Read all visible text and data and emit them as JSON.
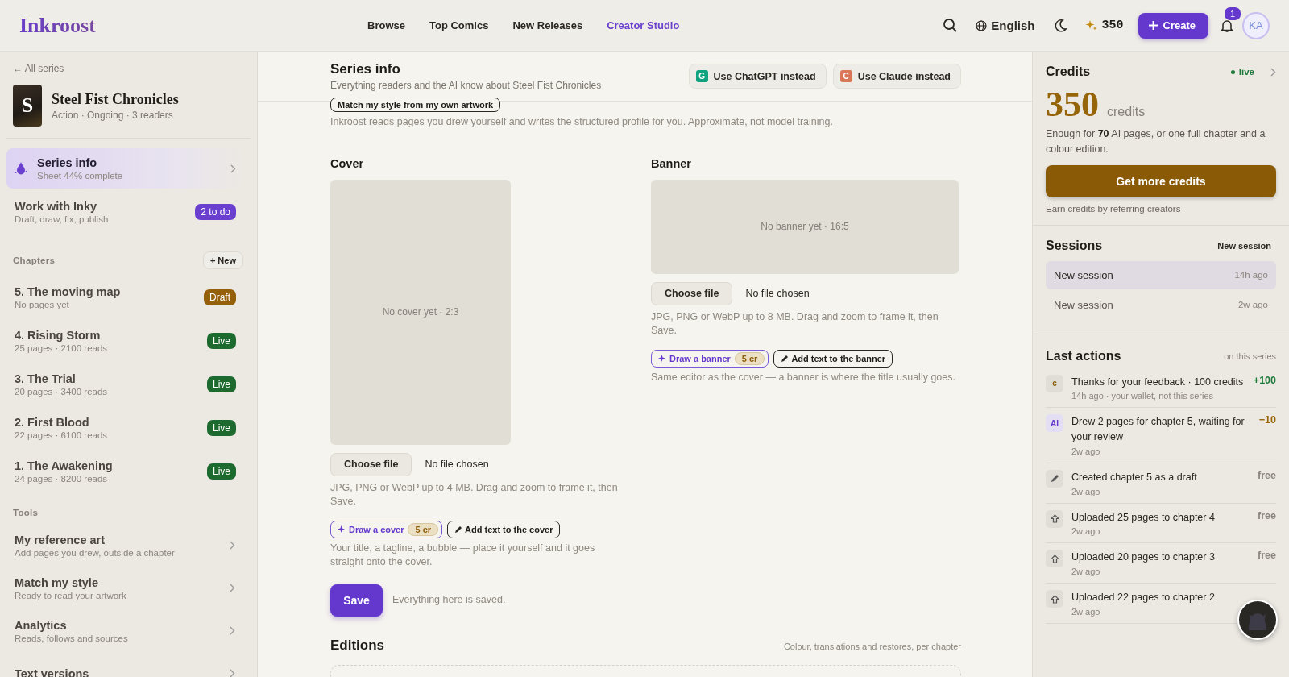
{
  "header": {
    "logo": "Inkroost",
    "nav": [
      {
        "label": "Browse",
        "selected": false
      },
      {
        "label": "Top Comics",
        "selected": false
      },
      {
        "label": "New Releases",
        "selected": false
      },
      {
        "label": "Creator Studio",
        "selected": true
      }
    ],
    "language": "English",
    "credits": "350",
    "create": "Create",
    "notifications": "1",
    "avatar": "KA"
  },
  "sidebar": {
    "back": "← All series",
    "series": {
      "cover_letter": "S",
      "title": "Steel Fist Chronicles",
      "meta": "Action · Ongoing · 3 readers"
    },
    "items": [
      {
        "kind": "progress",
        "title": "Series info",
        "subtitle": "Sheet 44% complete",
        "selected": true
      },
      {
        "kind": "badge",
        "title": "Work with Inky",
        "subtitle": "Draft, draw, fix, publish",
        "badge": "2 to do",
        "selected": false
      }
    ],
    "chapters_label": "Chapters",
    "new_button": "+ New",
    "chapters": [
      {
        "title": "5. The moving map",
        "subtitle": "No pages yet",
        "status": "Draft",
        "kind": "draft"
      },
      {
        "title": "4. Rising Storm",
        "subtitle": "25 pages · 2100 reads",
        "status": "Live",
        "kind": "live"
      },
      {
        "title": "3. The Trial",
        "subtitle": "20 pages · 3400 reads",
        "status": "Live",
        "kind": "live"
      },
      {
        "title": "2. First Blood",
        "subtitle": "22 pages · 6100 reads",
        "status": "Live",
        "kind": "live"
      },
      {
        "title": "1. The Awakening",
        "subtitle": "24 pages · 8200 reads",
        "status": "Live",
        "kind": "live"
      }
    ],
    "tools_label": "Tools",
    "tools": [
      {
        "title": "My reference art",
        "subtitle": "Add pages you drew, outside a chapter"
      },
      {
        "title": "Match my style",
        "subtitle": "Ready to read your artwork"
      },
      {
        "title": "Analytics",
        "subtitle": "Reads, follows and sources"
      },
      {
        "title": "Text versions"
      }
    ]
  },
  "main": {
    "title": "Series info",
    "subtitle": "Everything readers and the AI know about Steel Fist Chronicles",
    "assist_buttons": [
      {
        "letter": "G",
        "label": "Use ChatGPT instead",
        "color": "#10a37f"
      },
      {
        "letter": "C",
        "label": "Use Claude instead",
        "color": "#d97757"
      }
    ],
    "style_button": "Match my style from my own artwork",
    "style_note": "Inkroost reads pages you drew yourself and writes the structured profile for you. Approximate, not model training.",
    "media": [
      {
        "kind": "cover",
        "title": "Cover",
        "placeholder": "No cover yet · 2:3",
        "choose": "Choose file",
        "file": "No file chosen",
        "hint": "JPG, PNG or WebP up to 4 MB. Drag and zoom to frame it, then Save.",
        "draw": "Draw a cover",
        "cost": "5 cr",
        "text_button": "Add text to the cover",
        "note": "Your title, a tagline, a bubble — place it yourself and it goes straight onto the cover."
      },
      {
        "kind": "banner",
        "title": "Banner",
        "placeholder": "No banner yet · 16:5",
        "choose": "Choose file",
        "file": "No file chosen",
        "hint": "JPG, PNG or WebP up to 8 MB. Drag and zoom to frame it, then Save.",
        "draw": "Draw a banner",
        "cost": "5 cr",
        "text_button": "Add text to the banner",
        "note": "Same editor as the cover — a banner is where the title usually goes."
      }
    ],
    "save": "Save",
    "save_note": "Everything here is saved.",
    "editions": {
      "title": "Editions",
      "note": "Colour, translations and restores, per chapter"
    }
  },
  "right": {
    "credits": {
      "title": "Credits",
      "live": "live",
      "amount": "350",
      "unit": "credits",
      "note": "Enough for **70** AI pages, or one full chapter and a colour edition.",
      "button": "Get more credits",
      "referral": "Earn credits by referring creators"
    },
    "sessions": {
      "title": "Sessions",
      "new": "New session",
      "items": [
        {
          "label": "New session",
          "time": "14h ago",
          "selected": true
        },
        {
          "label": "New session",
          "time": "2w ago",
          "selected": false
        }
      ]
    },
    "actions": {
      "title": "Last actions",
      "scope": "on this series",
      "items": [
        {
          "kind": "letter",
          "icon_text": "c",
          "text": "Thanks for your feedback · 100 credits",
          "meta": "14h ago · your wallet, not this series",
          "amount": {
            "text": "+100",
            "color": "#1d7a3a"
          }
        },
        {
          "kind": "ai",
          "icon_text": "AI",
          "text": "Drew 2 pages for chapter 5, waiting for your review",
          "meta": "2w ago",
          "amount": {
            "text": "−10",
            "color": "#96650a"
          }
        },
        {
          "kind": "pencil",
          "text": "Created chapter 5 as a draft",
          "meta": "2w ago",
          "amount": {
            "text": "free",
            "color": "#8a857d"
          }
        },
        {
          "kind": "upload",
          "text": "Uploaded 25 pages to chapter 4",
          "meta": "2w ago",
          "amount": {
            "text": "free",
            "color": "#8a857d"
          }
        },
        {
          "kind": "upload",
          "text": "Uploaded 20 pages to chapter 3",
          "meta": "2w ago",
          "amount": {
            "text": "free",
            "color": "#8a857d"
          }
        },
        {
          "kind": "upload",
          "text": "Uploaded 22 pages to chapter 2",
          "meta": "2w ago"
        }
      ]
    }
  }
}
